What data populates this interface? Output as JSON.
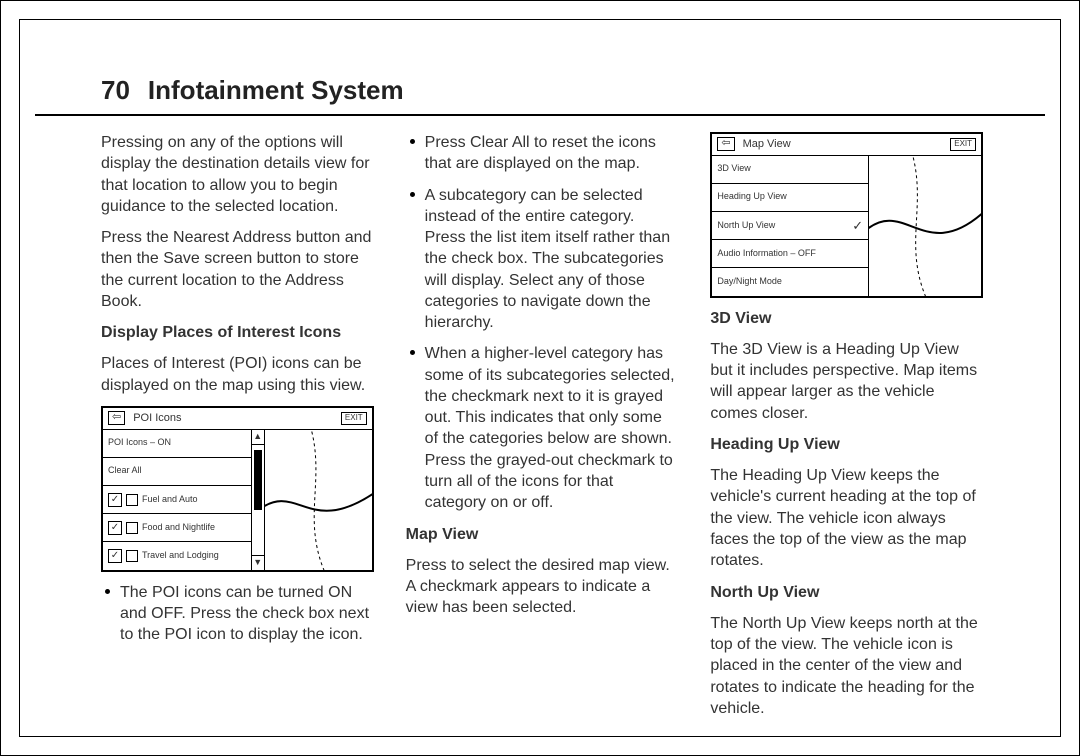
{
  "page_number": "70",
  "section_title": "Infotainment System",
  "col1": {
    "p1": "Pressing on any of the options will display the destination details view for that location to allow you to begin guidance to the selected location.",
    "p2": "Press the Nearest Address button and then the Save screen button to store the current location to the Address Book.",
    "sub1": "Display Places of Interest Icons",
    "p3": "Places of Interest (POI) icons can be displayed on the map using this view.",
    "bullet1": "The POI icons can be turned ON and OFF. Press the check box next to the POI icon to display the icon."
  },
  "poi_screenshot": {
    "title": "POI Icons",
    "exit": "EXIT",
    "rows": [
      {
        "label": "POI Icons – ON",
        "checkbox": false,
        "icon": false
      },
      {
        "label": "Clear All",
        "checkbox": false,
        "icon": false
      },
      {
        "label": "Fuel and Auto",
        "checkbox": true,
        "icon": true
      },
      {
        "label": "Food and Nightlife",
        "checkbox": true,
        "icon": true
      },
      {
        "label": "Travel and Lodging",
        "checkbox": true,
        "icon": true
      }
    ]
  },
  "col2": {
    "bullet1": "Press Clear All to reset the icons that are displayed on the map.",
    "bullet2": "A subcategory can be selected instead of the entire category. Press the list item itself rather than the check box. The subcategories will display. Select any of those categories to navigate down the hierarchy.",
    "bullet3": "When a higher-level category has some of its subcategories selected, the checkmark next to it is grayed out. This indicates that only some of the categories below are shown. Press the grayed-out checkmark to turn all of the icons for that category on or off.",
    "sub1": "Map View",
    "p1": "Press to select the desired map view. A checkmark appears to indicate a view has been selected."
  },
  "mapview_screenshot": {
    "title": "Map View",
    "exit": "EXIT",
    "rows": [
      {
        "label": "3D View",
        "check": false
      },
      {
        "label": "Heading Up View",
        "check": false
      },
      {
        "label": "North Up View",
        "check": true
      },
      {
        "label": "Audio Information – OFF",
        "check": false
      },
      {
        "label": "Day/Night Mode",
        "check": false
      }
    ]
  },
  "col3": {
    "sub1": "3D View",
    "p1": "The 3D View is a Heading Up View but it includes perspective. Map items will appear larger as the vehicle comes closer.",
    "sub2": "Heading Up View",
    "p2": "The Heading Up View keeps the vehicle's current heading at the top of the view. The vehicle icon always faces the top of the view as the map rotates.",
    "sub3": "North Up View",
    "p3": "The North Up View keeps north at the top of the view. The vehicle icon is placed in the center of the view and rotates to indicate the heading for the vehicle."
  }
}
